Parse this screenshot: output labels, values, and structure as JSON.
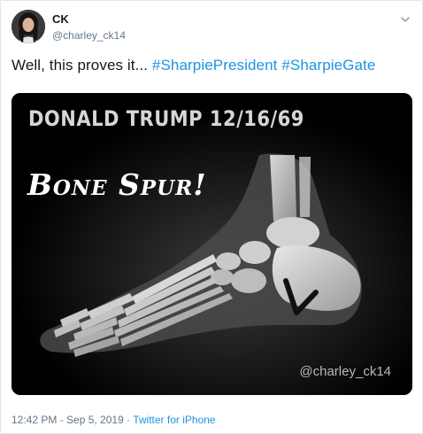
{
  "user": {
    "display_name": "CK",
    "handle": "@charley_ck14",
    "avatar_icon": "profile-photo"
  },
  "tweet": {
    "text_prefix": "Well, this proves it... ",
    "hashtags": [
      "#SharpiePresident",
      "#SharpieGate"
    ]
  },
  "media": {
    "title": "DONALD TRUMP 12/16/69",
    "caption": "Bone Spur!",
    "watermark": "@charley_ck14",
    "icon": "foot-xray-image"
  },
  "footer": {
    "timestamp": "12:42 PM - Sep 5, 2019",
    "separator": "·",
    "source": "Twitter for iPhone"
  },
  "colors": {
    "link": "#1b95e0",
    "muted": "#657786",
    "text": "#14171a"
  }
}
